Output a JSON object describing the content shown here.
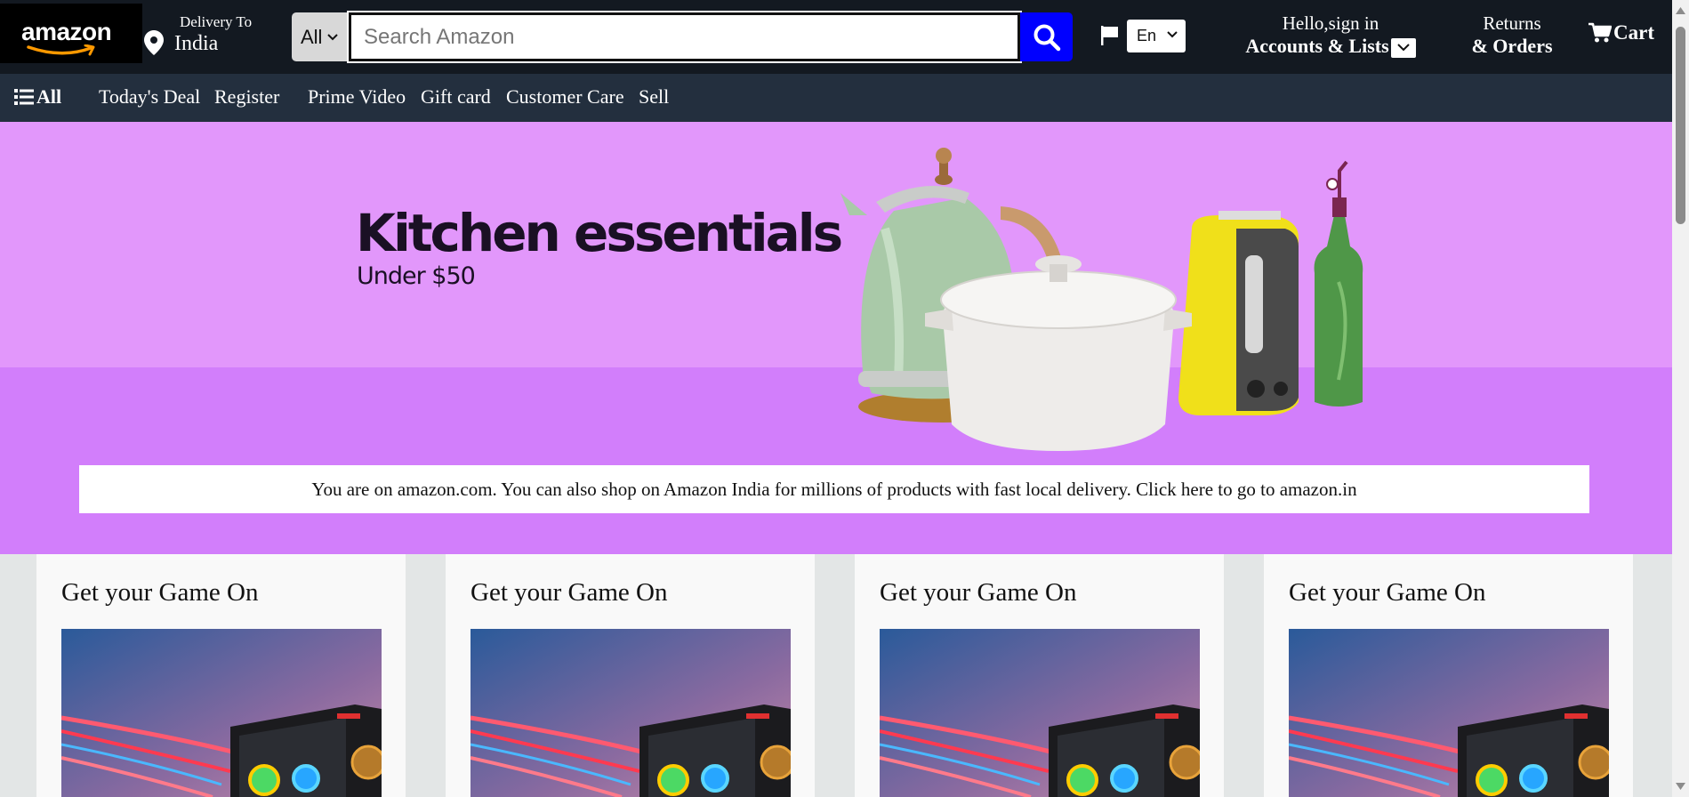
{
  "header": {
    "logo_text": "amazon",
    "delivery_small": "Delivery To",
    "delivery_big": "India",
    "search_category": "All",
    "search_placeholder": "Search Amazon",
    "language": "En",
    "account_line1": "Hello,sign in",
    "account_line2": "Accounts & Lists",
    "returns_line1": "Returns",
    "returns_line2": "& Orders",
    "cart_label": "Cart"
  },
  "nav": {
    "all_label": "All",
    "items": [
      "Today's Deal",
      "Register",
      "Prime Video",
      "Gift card",
      "Customer Care",
      "Sell"
    ]
  },
  "hero": {
    "title": "Kitchen essentials",
    "subtitle": "Under $50"
  },
  "notice": {
    "text": "You are on amazon.com. You can also shop on Amazon India for millions of products with fast local delivery. Click here to go to amazon.in"
  },
  "cards": [
    {
      "title": "Get your Game On"
    },
    {
      "title": "Get your Game On"
    },
    {
      "title": "Get your Game On"
    },
    {
      "title": "Get your Game On"
    }
  ],
  "colors": {
    "header_bg": "#131921",
    "nav_bg": "#232f3e",
    "search_button": "#0000ff",
    "hero_top": "#e297fb",
    "hero_bottom": "#d27efb",
    "page_bg": "#e3e6e6"
  },
  "icons": [
    "location-pin-icon",
    "chevron-down-icon",
    "search-icon",
    "flag-icon",
    "cart-icon",
    "menu-list-icon"
  ]
}
